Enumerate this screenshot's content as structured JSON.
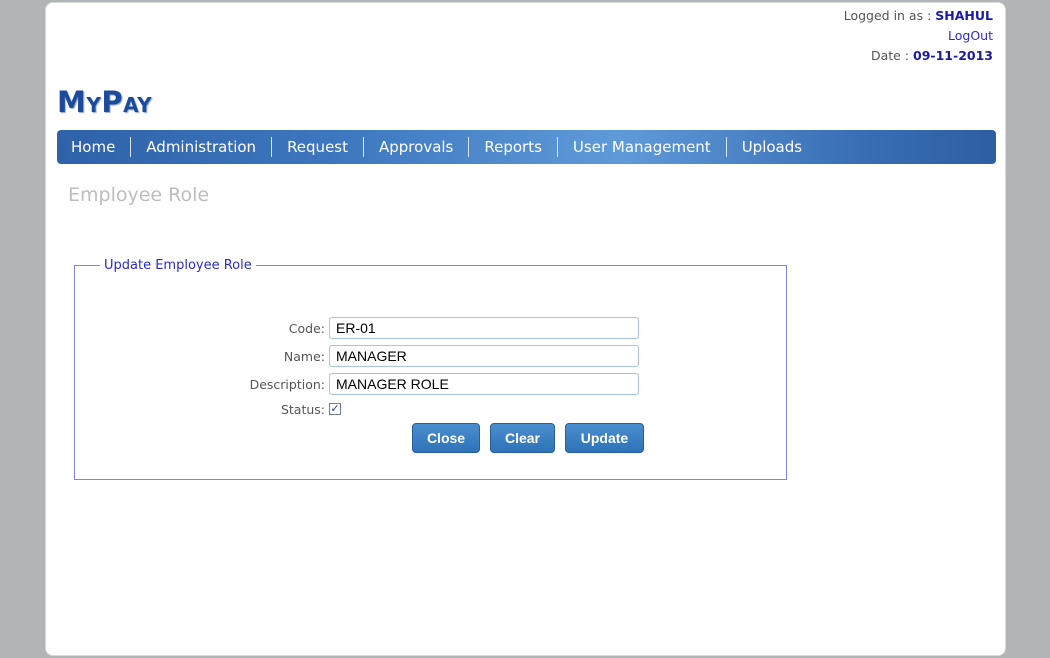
{
  "header": {
    "logged_in_label": "Logged in as :",
    "username": "SHAHUL",
    "logout_label": "LogOut",
    "date_label": "Date :",
    "date_value": "09-11-2013"
  },
  "logo": "MyPay",
  "nav": [
    "Home",
    "Administration",
    "Request",
    "Approvals",
    "Reports",
    "User Management",
    "Uploads"
  ],
  "page_title": "Employee Role",
  "form": {
    "legend": "Update Employee Role",
    "code_label": "Code:",
    "code_value": "ER-01",
    "name_label": "Name:",
    "name_value": "MANAGER",
    "description_label": "Description:",
    "description_value": "MANAGER ROLE",
    "status_label": "Status:",
    "status_checked": true,
    "buttons": {
      "close": "Close",
      "clear": "Clear",
      "update": "Update"
    }
  },
  "colors": {
    "accent": "#2f62a8",
    "link": "#2a2acc",
    "button": "#3a7fc4"
  }
}
